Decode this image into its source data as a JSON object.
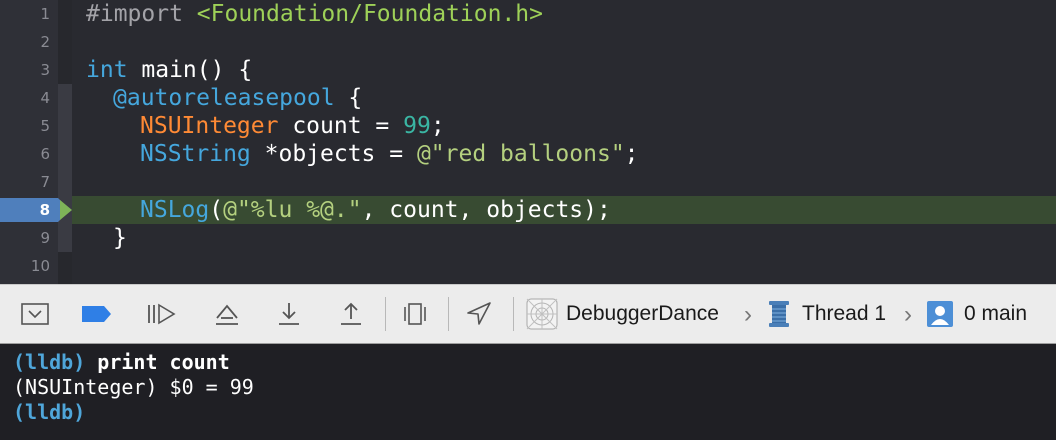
{
  "editor": {
    "line_numbers": [
      "1",
      "2",
      "3",
      "4",
      "5",
      "6",
      "7",
      "8",
      "9",
      "10"
    ],
    "line1": {
      "directive": "#import",
      "path": "<Foundation/Foundation.h>"
    },
    "line3": {
      "type": "int",
      "rest": " main() {"
    },
    "line4": {
      "keyword": "@autoreleasepool",
      "rest": " {"
    },
    "line5": {
      "type": "NSUInteger",
      "rest": " count = ",
      "number": "99",
      "end": ";"
    },
    "line6": {
      "type": "NSString",
      "rest": " *objects = ",
      "string": "@\"red balloons\"",
      "end": ";"
    },
    "line8": {
      "fn": "NSLog",
      "open": "(",
      "string": "@\"%lu %@.\"",
      "rest": ", count, objects);"
    },
    "line9": {
      "text": "}"
    },
    "current_line": "8"
  },
  "debug_bar": {
    "buttons": [
      "hide-debug-area",
      "breakpoints-toggle",
      "continue",
      "step-over",
      "step-into",
      "step-out",
      "debug-view-hierarchy",
      "simulate-location"
    ],
    "breadcrumb": {
      "target": "DebuggerDance",
      "thread": "Thread 1",
      "frame": "0 main"
    }
  },
  "console": {
    "lines": [
      {
        "prompt": "(lldb)",
        "command": " print count"
      },
      {
        "output": "(NSUInteger) $0 = 99"
      },
      {
        "prompt": "(lldb)"
      }
    ]
  },
  "colors": {
    "editor_bg": "#292a30",
    "current_line_bg": "#384b32",
    "breakpoint": "#4f7fbc",
    "keyword": "#45a7dd",
    "type_orange": "#ff8a35",
    "string": "#b4d07f",
    "number": "#3ab5a3"
  }
}
